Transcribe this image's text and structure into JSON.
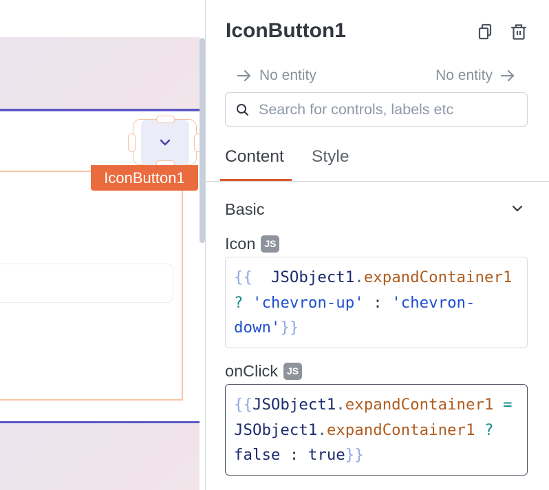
{
  "canvas": {
    "selected_widget_label": "IconButton1",
    "icon_button_icon": "chevron-down"
  },
  "pane": {
    "title": "IconButton1",
    "actions": {
      "copy": "copy-icon",
      "delete": "trash-icon"
    },
    "entity_nav": {
      "left": "No entity",
      "right": "No entity"
    },
    "search": {
      "placeholder": "Search for controls, labels etc",
      "value": ""
    },
    "tabs": [
      {
        "label": "Content",
        "active": true
      },
      {
        "label": "Style",
        "active": false
      }
    ],
    "section": {
      "title": "Basic",
      "expanded": true
    },
    "properties": [
      {
        "label": "Icon",
        "badge": "JS",
        "lines": [
          [
            {
              "t": "brace",
              "v": "{{"
            },
            {
              "t": "space",
              "v": "  "
            },
            {
              "t": "ident",
              "v": "JSObject1"
            },
            {
              "t": "punct",
              "v": "."
            },
            {
              "t": "prop",
              "v": "expandContainer1"
            }
          ],
          [
            {
              "t": "op",
              "v": "?"
            },
            {
              "t": "space",
              "v": " "
            },
            {
              "t": "string",
              "v": "'chevron-up'"
            },
            {
              "t": "space",
              "v": " "
            },
            {
              "t": "colon",
              "v": ":"
            },
            {
              "t": "space",
              "v": " "
            },
            {
              "t": "string",
              "v": "'chevron-"
            }
          ],
          [
            {
              "t": "string",
              "v": "down'"
            },
            {
              "t": "brace",
              "v": "}}"
            }
          ]
        ]
      },
      {
        "label": "onClick",
        "badge": "JS",
        "lines": [
          [
            {
              "t": "brace",
              "v": "{{"
            },
            {
              "t": "ident",
              "v": "JSObject1"
            },
            {
              "t": "punct",
              "v": "."
            },
            {
              "t": "prop",
              "v": "expandContainer1"
            },
            {
              "t": "space",
              "v": " "
            },
            {
              "t": "op",
              "v": "="
            }
          ],
          [
            {
              "t": "ident",
              "v": "JSObject1"
            },
            {
              "t": "punct",
              "v": "."
            },
            {
              "t": "prop",
              "v": "expandContainer1"
            },
            {
              "t": "space",
              "v": " "
            },
            {
              "t": "op",
              "v": "?"
            }
          ],
          [
            {
              "t": "ident",
              "v": "false"
            },
            {
              "t": "space",
              "v": " "
            },
            {
              "t": "colon",
              "v": ":"
            },
            {
              "t": "space",
              "v": " "
            },
            {
              "t": "ident",
              "v": "true"
            },
            {
              "t": "brace",
              "v": "}}"
            }
          ]
        ]
      }
    ]
  },
  "colors": {
    "accent": "#e0572a",
    "widget_tag": "#ea6b3e",
    "selection_outline": "#f6c0a4",
    "container_border": "#f7c4a2",
    "canvas_divider": "#5b57c6",
    "js_badge": "#8f949c"
  }
}
